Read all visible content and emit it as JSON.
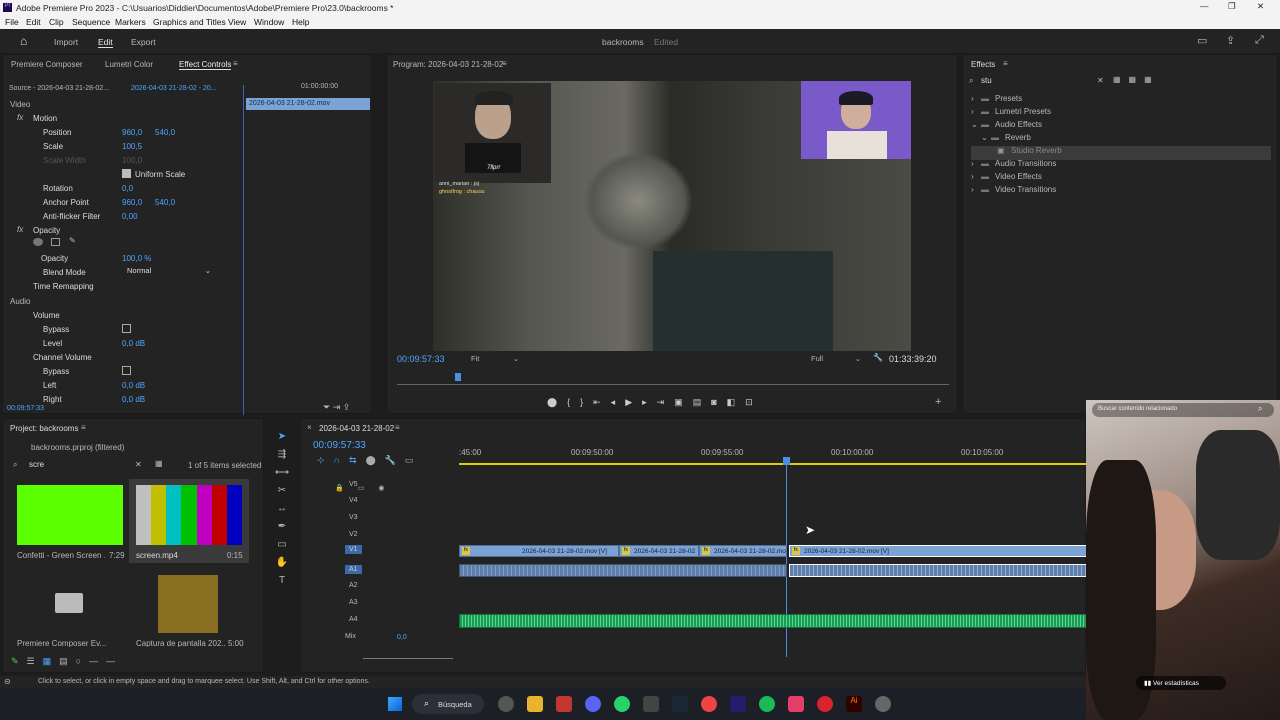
{
  "window": {
    "title": "Adobe Premiere Pro 2023 - C:\\Usuarios\\Diddier\\Documentos\\Adobe\\Premiere Pro\\23.0\\backrooms *"
  },
  "menu": [
    "File",
    "Edit",
    "Clip",
    "Sequence",
    "Markers",
    "Graphics and Titles",
    "View",
    "Window",
    "Help"
  ],
  "header": {
    "tabs": [
      "Import",
      "Edit",
      "Export"
    ],
    "project": "backrooms",
    "status": "Edited"
  },
  "effect_panel": {
    "tabs": [
      "Premiere Composer",
      "Lumetri Color",
      "Effect Controls"
    ],
    "source": "Source - 2026-04-03 21-28-02...",
    "clip": "2026-04-03 21-28-02 - 20...",
    "timecode_top": "01:00:00:00",
    "clip_bar": "2026-04-03 21-28-02.mov",
    "video_label": "Video",
    "motion": "Motion",
    "position": "Position",
    "pos_x": "960,0",
    "pos_y": "540,0",
    "scale": "Scale",
    "scale_val": "100,5",
    "scale_width": "Scale Width",
    "scale_width_val": "100,0",
    "uniform": "Uniform Scale",
    "rotation": "Rotation",
    "rotation_val": "0,0",
    "anchor": "Anchor Point",
    "anc_x": "960,0",
    "anc_y": "540,0",
    "antiflicker": "Anti-flicker Filter",
    "antiflicker_val": "0,00",
    "opacity": "Opacity",
    "opacity_val": "100,0 %",
    "blend": "Blend Mode",
    "blend_val": "Normal",
    "time_remap": "Time Remapping",
    "audio_label": "Audio",
    "volume": "Volume",
    "bypass": "Bypass",
    "level": "Level",
    "level_val": "0,0 dB",
    "channel_volume": "Channel Volume",
    "left": "Left",
    "left_val": "0,0 dB",
    "right": "Right",
    "right_val": "0,0 dB",
    "bottom_tc": "00:09:57:33"
  },
  "program": {
    "title": "Program: 2026-04-03 21-28-02",
    "timecode": "00:09:57:33",
    "fit": "Fit",
    "full": "Full",
    "duration": "01:33:39:20",
    "progress": 0.11,
    "chat": [
      "anni_mariari : jsj",
      "ghostfrog : chauuu"
    ],
    "cam_text": "7llprr"
  },
  "effects": {
    "title": "Effects",
    "search": "stu",
    "tree": [
      "Presets",
      "Lumetri Presets",
      "Audio Effects",
      "Reverb",
      "Studio Reverb",
      "Audio Transitions",
      "Video Effects",
      "Video Transitions"
    ]
  },
  "project": {
    "title": "Project: backrooms",
    "file": "backrooms.prproj (filtered)",
    "search": "scre",
    "count": "1 of 5 items selected",
    "items": [
      {
        "name": "Confetti - Green Screen ...",
        "dur": "7:29"
      },
      {
        "name": "screen.mp4",
        "dur": "0:15"
      },
      {
        "name": "Premiere Composer Ev...",
        "dur": ""
      },
      {
        "name": "Captura de pantalla 202...",
        "dur": "5:00"
      }
    ]
  },
  "timeline": {
    "tab": "2026-04-03 21-28-02",
    "timecode": "00:09:57:33",
    "ruler": [
      ":45:00",
      "00:09:50:00",
      "00:09:55:00",
      "00:10:00:00",
      "00:10:05:00"
    ],
    "tracks_v": [
      "V5",
      "V4",
      "V3",
      "V2",
      "V1"
    ],
    "tracks_a": [
      "A1",
      "A2",
      "A3",
      "A4"
    ],
    "mix": "Mix",
    "mix_val": "0,0",
    "clips": [
      "2026-04-03 21-28-02.mov [V]",
      "2026-04-03 21-28-02",
      "2026-04-03 21-28-02.mo",
      "2026-04-03 21-28-02.mov [V]"
    ]
  },
  "status": "Click to select, or click in empty space and drag to marquee select. Use Shift, Alt, and Ctrl for other options.",
  "overlay": {
    "search": "Buscar contenido relacionado",
    "stats": "Ver estadísticas"
  },
  "taskbar": {
    "search": "Búsqueda"
  }
}
